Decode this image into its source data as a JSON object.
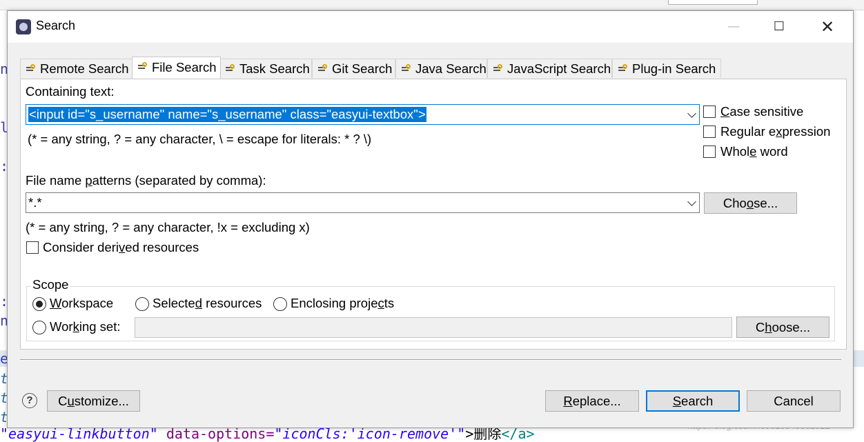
{
  "dialog": {
    "title": "Search",
    "window_controls": {
      "minimize": "—",
      "maximize": "☐",
      "close": "✕"
    }
  },
  "tabs": [
    {
      "label": "Remote Search",
      "icon": "remote-search-icon",
      "active": false
    },
    {
      "label": "File Search",
      "icon": "file-search-icon",
      "active": true
    },
    {
      "label": "Task Search",
      "icon": "task-search-icon",
      "active": false
    },
    {
      "label": "Git Search",
      "icon": "git-search-icon",
      "active": false
    },
    {
      "label": "Java Search",
      "icon": "java-search-icon",
      "active": false
    },
    {
      "label": "JavaScript Search",
      "icon": "javascript-search-icon",
      "active": false
    },
    {
      "label": "Plug-in Search",
      "icon": "plugin-search-icon",
      "active": false
    }
  ],
  "file_search": {
    "containing_text_label": "Containing text:",
    "containing_text_value": "<input id=\"s_username\" name=\"s_username\" class=\"easyui-textbox\">",
    "containing_text_hint": "(* = any string, ? = any character, \\ = escape for literals: * ? \\)",
    "options": {
      "case_sensitive": {
        "pre": "",
        "key": "C",
        "post": "ase sensitive",
        "checked": false
      },
      "regular_expression": {
        "pre": "Regular e",
        "key": "x",
        "post": "pression",
        "checked": false
      },
      "whole_word": {
        "pre": "Whol",
        "key": "e",
        "post": " word",
        "checked": false
      }
    },
    "patterns_label_pre": "File name ",
    "patterns_label_key": "p",
    "patterns_label_post": "atterns (separated by comma):",
    "patterns_value": "*.*",
    "patterns_choose_pre": "Cho",
    "patterns_choose_key": "o",
    "patterns_choose_post": "se...",
    "patterns_hint": "(* = any string, ? = any character, !x = excluding x)",
    "derived_pre": "Consider deri",
    "derived_key": "v",
    "derived_post": "ed resources",
    "derived_checked": false
  },
  "scope": {
    "legend": "Scope",
    "workspace": {
      "pre": "",
      "key": "W",
      "post": "orkspace",
      "selected": true
    },
    "selected_resources": {
      "pre": "Selecte",
      "key": "d",
      "post": " resources",
      "selected": false
    },
    "enclosing_projects": {
      "pre": "Enclosing proje",
      "key": "c",
      "post": "ts",
      "selected": false
    },
    "working_set": {
      "pre": "Wor",
      "key": "k",
      "post": "ing set:",
      "selected": false,
      "value": ""
    },
    "choose_pre": "C",
    "choose_key": "h",
    "choose_post": "oose..."
  },
  "footer": {
    "help": "?",
    "customize_pre": "C",
    "customize_key": "u",
    "customize_post": "stomize...",
    "replace_pre": "",
    "replace_key": "R",
    "replace_post": "eplace...",
    "search_pre": "",
    "search_key": "S",
    "search_post": "earch",
    "cancel": "Cancel"
  },
  "background_editor": {
    "gutter_chars": [
      "n",
      "l",
      ":",
      ":",
      "n",
      "e",
      "t",
      "t",
      "t"
    ],
    "code_line": {
      "part1": "\"easyui-linkbutton\"",
      "part2": " data-options=",
      "part3": "\"iconCls:'icon-remove'\"",
      "part4": ">删除",
      "part5": "</a>"
    },
    "watermark": "https://blog.csdn.net/u18545361822"
  },
  "colors": {
    "selection": "#0078d7",
    "dialog_bg": "#f0f0f0",
    "panel_bg": "#ffffff"
  }
}
